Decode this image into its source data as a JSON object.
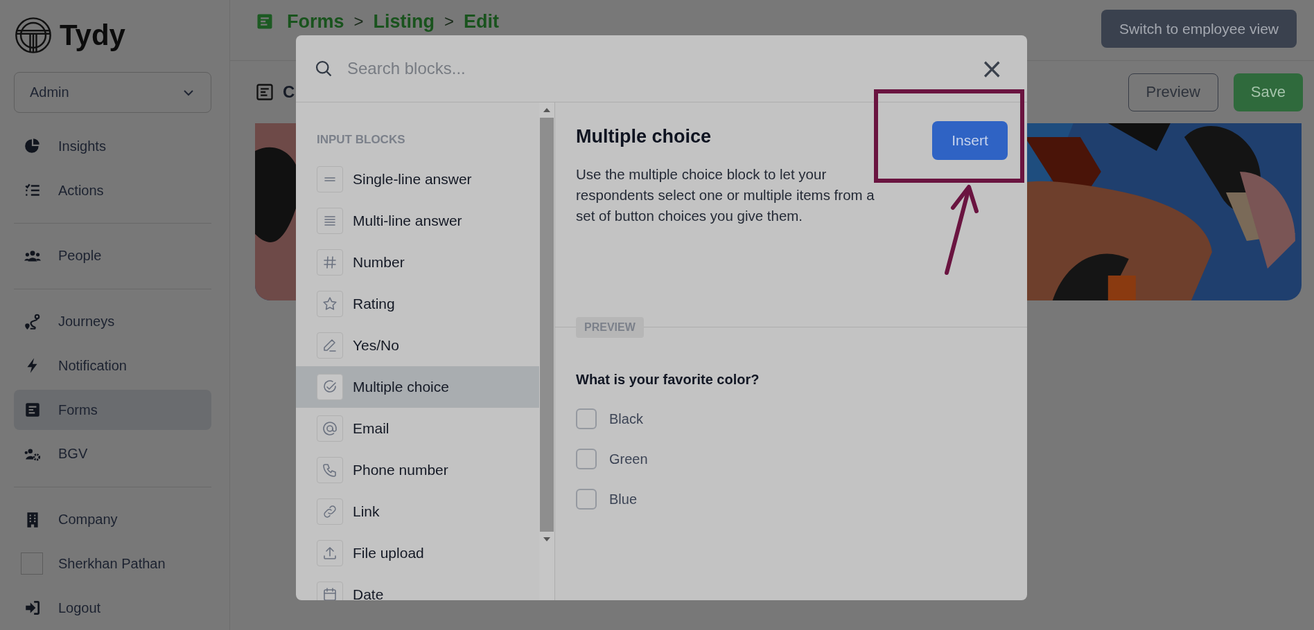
{
  "sidebar": {
    "logo": "Tydy",
    "role_select": {
      "value": "Admin"
    },
    "groups": [
      {
        "items": [
          {
            "label": "Insights",
            "kind": "nav",
            "selected": false
          },
          {
            "label": "Actions",
            "kind": "nav",
            "selected": false
          }
        ]
      },
      {
        "items": [
          {
            "label": "People",
            "kind": "nav",
            "selected": false
          }
        ]
      },
      {
        "items": [
          {
            "label": "Journeys",
            "kind": "nav",
            "selected": false
          },
          {
            "label": "Notification",
            "kind": "nav",
            "selected": false
          },
          {
            "label": "Forms",
            "kind": "nav",
            "selected": true
          },
          {
            "label": "BGV",
            "kind": "nav",
            "selected": false
          }
        ]
      },
      {
        "items": [
          {
            "label": "Company",
            "kind": "nav",
            "selected": false
          },
          {
            "label": "Sherkhan Pathan",
            "kind": "user",
            "selected": false
          },
          {
            "label": "Logout",
            "kind": "nav",
            "selected": false
          }
        ]
      }
    ]
  },
  "header": {
    "breadcrumb": [
      {
        "label": "Forms",
        "separator": ">"
      },
      {
        "label": "Listing",
        "separator": ">"
      },
      {
        "label": "Edit"
      }
    ],
    "switch_button": "Switch to employee view"
  },
  "toolbar": {
    "title": "C",
    "buttons": [
      {
        "label": "Preview",
        "kind": "outline"
      },
      {
        "label": "Save",
        "kind": "primary"
      }
    ]
  },
  "modal": {
    "search": {
      "placeholder": "Search blocks..."
    },
    "close": "×",
    "section_title": "INPUT BLOCKS",
    "blocks": [
      {
        "label": "Single-line answer",
        "selected": false
      },
      {
        "label": "Multi-line answer",
        "selected": false
      },
      {
        "label": "Number",
        "selected": false
      },
      {
        "label": "Rating",
        "selected": false
      },
      {
        "label": "Yes/No",
        "selected": false
      },
      {
        "label": "Multiple choice",
        "selected": true
      },
      {
        "label": "Email",
        "selected": false
      },
      {
        "label": "Phone number",
        "selected": false
      },
      {
        "label": "Link",
        "selected": false
      },
      {
        "label": "File upload",
        "selected": false
      },
      {
        "label": "Date",
        "selected": false
      }
    ],
    "detail": {
      "title": "Multiple choice",
      "insert_button": "Insert",
      "description": "Use the multiple choice block to let your respondents select one or multiple items from a set of button choices you give them.",
      "preview_label": "PREVIEW",
      "question": "What is your favorite color?",
      "options": [
        {
          "label": "Black",
          "checked": false
        },
        {
          "label": "Green",
          "checked": false
        },
        {
          "label": "Blue",
          "checked": false
        }
      ]
    }
  }
}
